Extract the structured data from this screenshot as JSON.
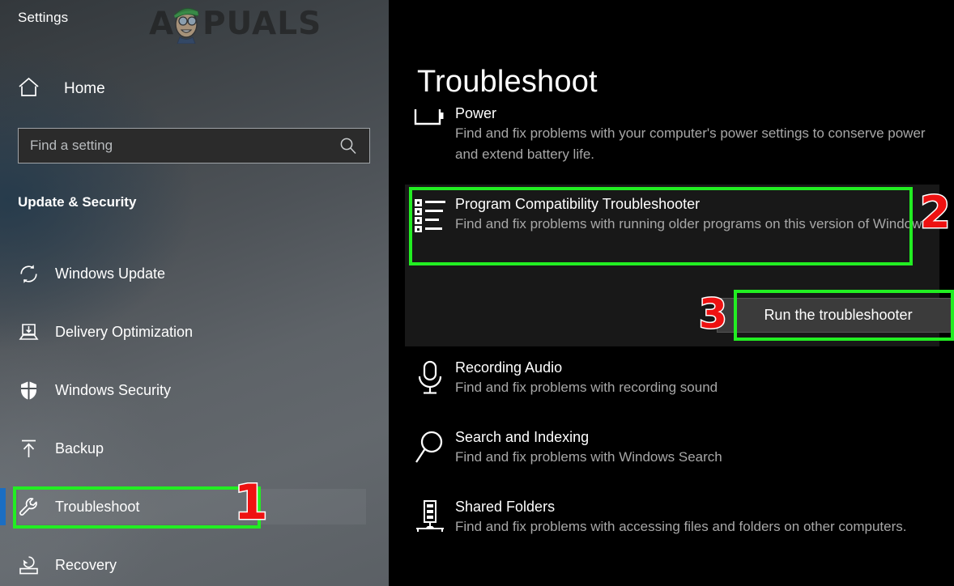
{
  "window": {
    "app_title": "Settings",
    "watermark": "APPUALS"
  },
  "sidebar": {
    "home_label": "Home",
    "home_icon": "home-icon",
    "search": {
      "placeholder": "Find a setting",
      "value": "",
      "icon": "search-icon"
    },
    "section_header": "Update & Security",
    "selected_item": "Troubleshoot",
    "accent_color": "#1b6ec2",
    "items": [
      {
        "label": "Windows Update",
        "icon": "sync-icon",
        "selected": false
      },
      {
        "label": "Delivery Optimization",
        "icon": "delivery-optimization-icon",
        "selected": false
      },
      {
        "label": "Windows Security",
        "icon": "shield-icon",
        "selected": false
      },
      {
        "label": "Backup",
        "icon": "upload-arrow-icon",
        "selected": false
      },
      {
        "label": "Troubleshoot",
        "icon": "wrench-icon",
        "selected": true
      },
      {
        "label": "Recovery",
        "icon": "recovery-icon",
        "selected": false
      }
    ]
  },
  "main": {
    "page_title": "Troubleshoot",
    "troubleshooters": [
      {
        "name": "Power",
        "description": "Find and fix problems with your computer's power settings to conserve power and extend battery life.",
        "icon": "battery-icon",
        "selected": false
      },
      {
        "name": "Program Compatibility Troubleshooter",
        "description": "Find and fix problems with running older programs on this version of Windows.",
        "icon": "bulleted-list-icon",
        "selected": true
      },
      {
        "name": "Recording Audio",
        "description": "Find and fix problems with recording sound",
        "icon": "microphone-icon",
        "selected": false
      },
      {
        "name": "Search and Indexing",
        "description": "Find and fix problems with Windows Search",
        "icon": "magnifier-icon",
        "selected": false
      },
      {
        "name": "Shared Folders",
        "description": "Find and fix problems with accessing files and folders on other computers.",
        "icon": "network-server-icon",
        "selected": false
      }
    ],
    "run_button_label": "Run the troubleshooter"
  },
  "annotations": {
    "highlight_color": "#22ee22",
    "number_color": "#ee1111",
    "steps": [
      {
        "number": "1",
        "target": "Troubleshoot"
      },
      {
        "number": "2",
        "target": "Program Compatibility Troubleshooter"
      },
      {
        "number": "3",
        "target": "Run the troubleshooter"
      }
    ]
  }
}
